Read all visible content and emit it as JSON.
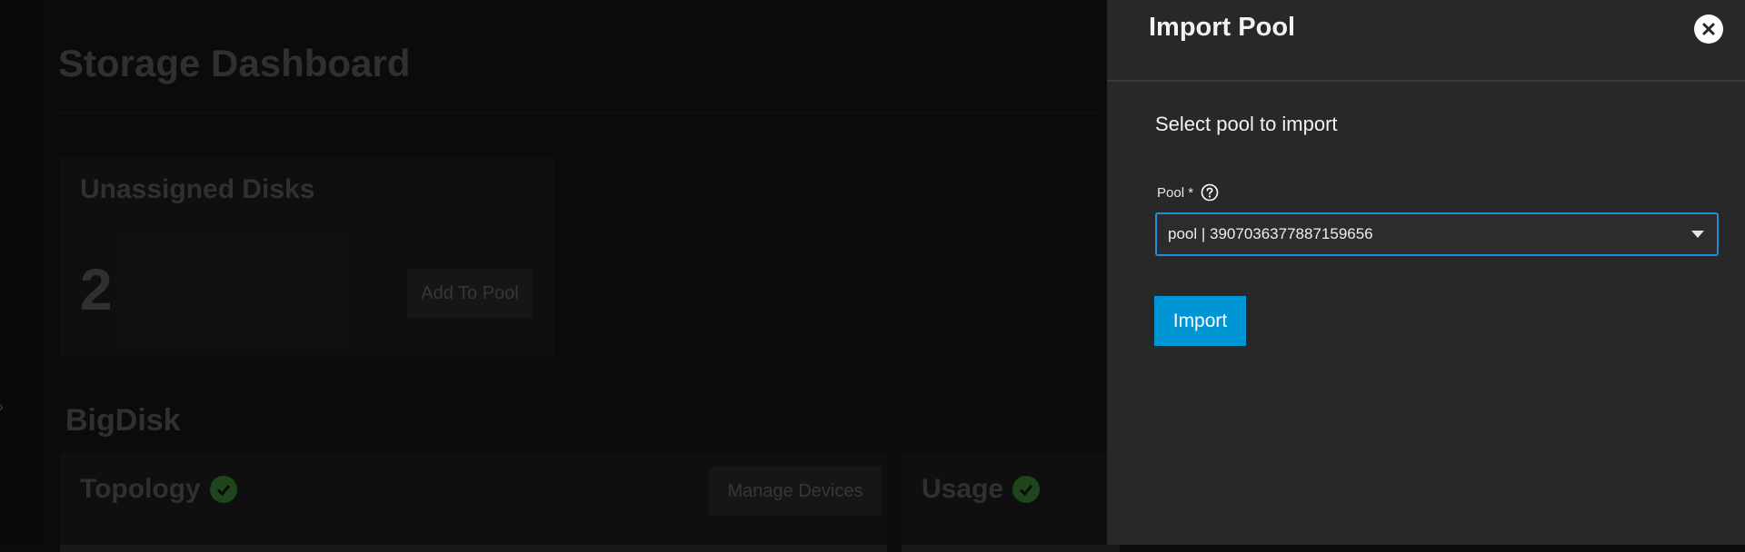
{
  "dashboard": {
    "title": "Storage Dashboard",
    "unassigned_card": {
      "title": "Unassigned Disks",
      "count": "2",
      "add_button_label": "Add To Pool"
    },
    "pool_section": {
      "title": "BigDisk",
      "topology_card": {
        "title": "Topology",
        "manage_button_label": "Manage Devices"
      },
      "usage_card": {
        "title": "Usage"
      }
    }
  },
  "panel": {
    "title": "Import Pool",
    "form_heading": "Select pool to import",
    "pool_field": {
      "label": "Pool *",
      "selected_value": "pool | 3907036377887159656"
    },
    "import_button_label": "Import"
  },
  "colors": {
    "accent": "#0095d5",
    "select_border": "#1f8fd6",
    "status_ok": "#2e6b2a",
    "panel_bg": "#282828"
  },
  "icons": {
    "close": "close-icon",
    "help": "help-circle-icon",
    "dropdown": "caret-down-icon",
    "status": "check-circle-icon",
    "sidebar_toggle": "chevron-right-icon"
  }
}
